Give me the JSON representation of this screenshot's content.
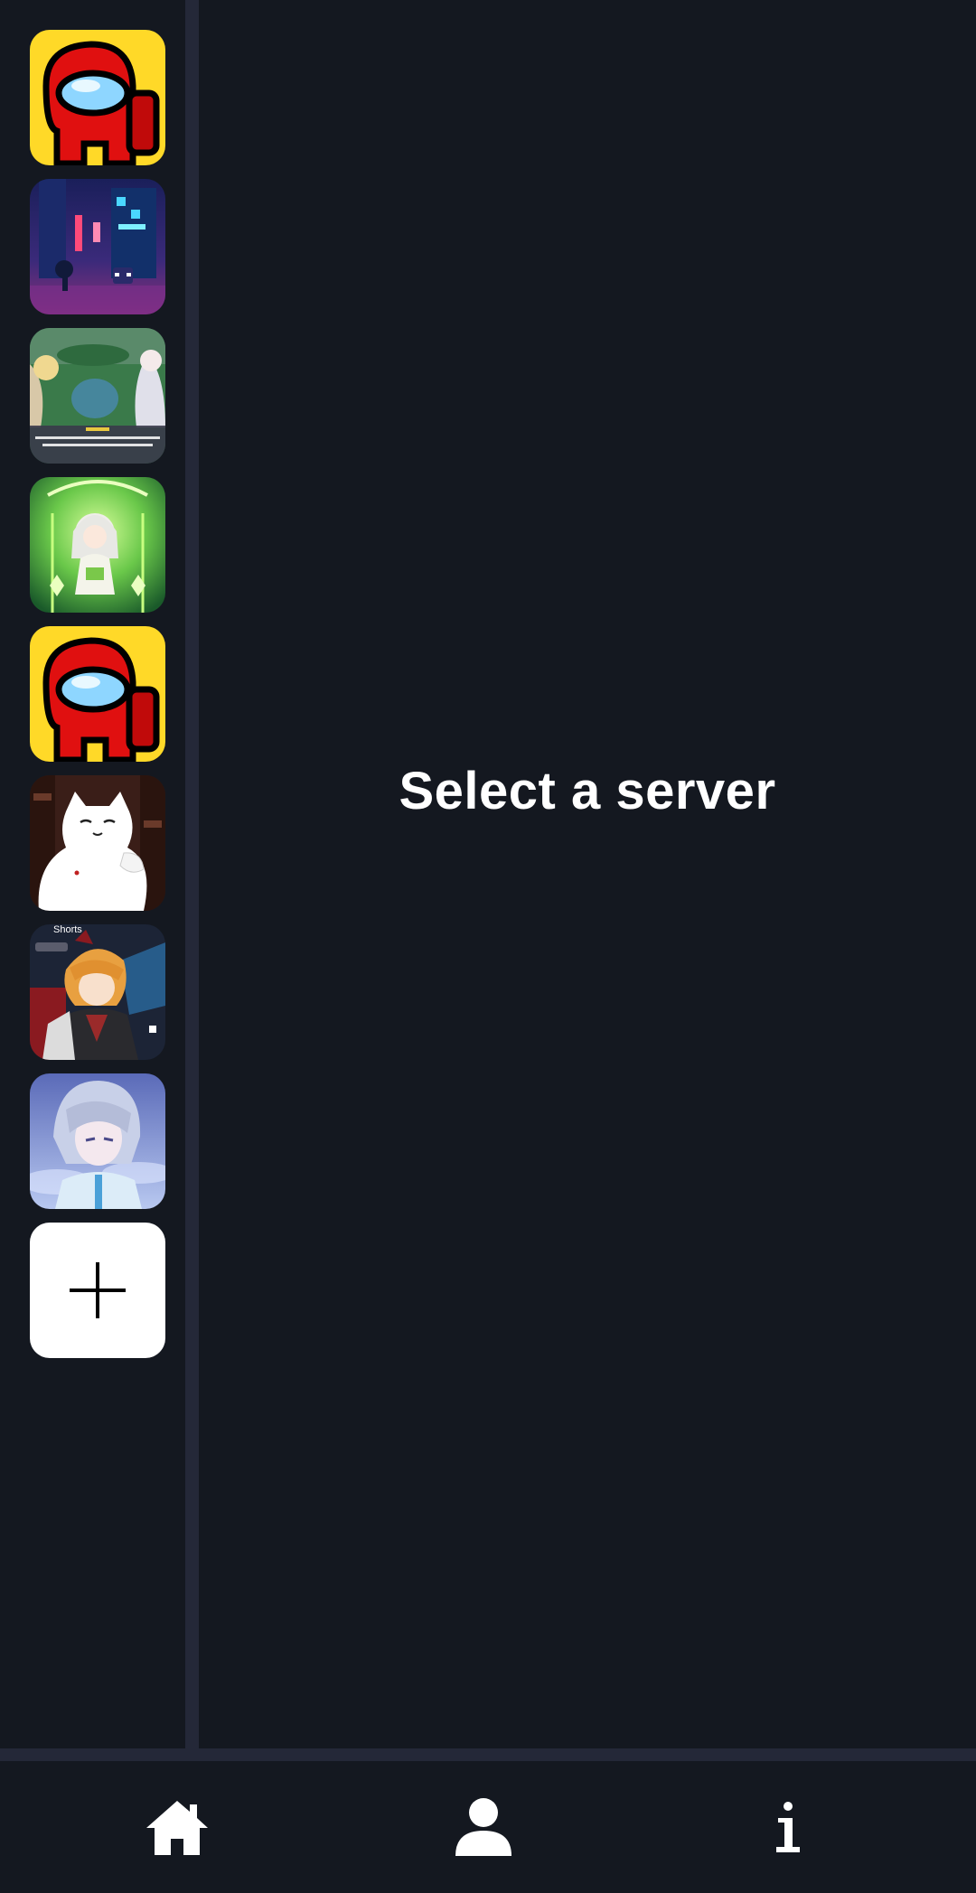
{
  "main": {
    "title": "Select a server"
  },
  "servers": [
    {
      "icon": "among-us-crewmate-icon"
    },
    {
      "icon": "neon-city-street-icon"
    },
    {
      "icon": "game-screenshot-icon"
    },
    {
      "icon": "anime-character-green-icon"
    },
    {
      "icon": "among-us-crewmate-icon"
    },
    {
      "icon": "white-cat-icon"
    },
    {
      "icon": "anime-character-orange-hair-icon",
      "caption": "Shorts"
    },
    {
      "icon": "anime-character-silver-hair-icon"
    }
  ],
  "add_server": {
    "icon": "plus-icon"
  },
  "nav": [
    {
      "icon": "home-icon"
    },
    {
      "icon": "profile-icon"
    },
    {
      "icon": "info-icon"
    }
  ]
}
